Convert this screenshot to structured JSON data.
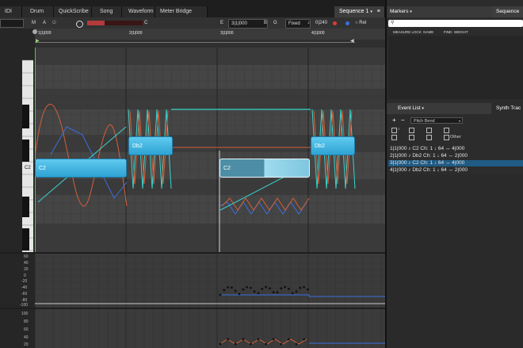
{
  "tabs": {
    "idi": "IDI",
    "drum": "Drum",
    "quickscribe": "QuickScribe",
    "song": "Song",
    "waveform": "Waveform",
    "meter_bridge": "Meter Bridge",
    "sequence": "Sequence 1",
    "markers": "Markers",
    "sequence_right": "Sequence"
  },
  "toolbar": {
    "m": "M",
    "a": "A",
    "c": "C",
    "e": "E",
    "time": "3|1|000",
    "b": "B",
    "g": "G",
    "fixed": "Fixed",
    "quant": "0|240",
    "rel": "Rel"
  },
  "ruler": {
    "bar1": "1|1|000",
    "bar2": "2|1|000",
    "bar3": "3|1|000",
    "bar4": "4|1|000"
  },
  "piano": {
    "c2": "C2"
  },
  "notes": [
    {
      "label": "C2",
      "state": "normal"
    },
    {
      "label": "Db2",
      "state": "normal"
    },
    {
      "label": "C2",
      "state": "selected"
    },
    {
      "label": "Db2",
      "state": "normal"
    }
  ],
  "ctl1_axis": [
    "60",
    "40",
    "20",
    "0",
    "-20",
    "-40",
    "-60",
    "-80",
    "-100"
  ],
  "ctl2_axis": [
    "100",
    "80",
    "60",
    "40",
    "20"
  ],
  "markers": {
    "columns": "MEASURE LOCK  NAME          FIND  WEIGHT",
    "search_placeholder": ""
  },
  "event_list": {
    "title": "Event List",
    "tab2": "Synth Trac",
    "filter": "Pitch Bend",
    "other": "Other",
    "rows": [
      "1|1|000  ♪ C2  Ch: 1 ↓ 64 ↔ 4|000",
      "2|1|000  ♪ Db2 Ch: 1 ↓ 64 ↔ 2|000",
      "3|1|000  ♪ C2  Ch: 1 ↓ 64 ↔ 4|000",
      "4|1|000  ♪ Db2 Ch: 1 ↓ 64 ↔ 2|000"
    ]
  },
  "colors": {
    "note_fill": "#3bb3de",
    "note_selected": "#8fd8ef",
    "pitch_line_red": "#d2603a",
    "pitch_line_blue": "#3a6fe0",
    "pitch_line_cyan": "#39d4cf",
    "playhead": "#57c93a",
    "selected_row": "#1f5b84"
  }
}
